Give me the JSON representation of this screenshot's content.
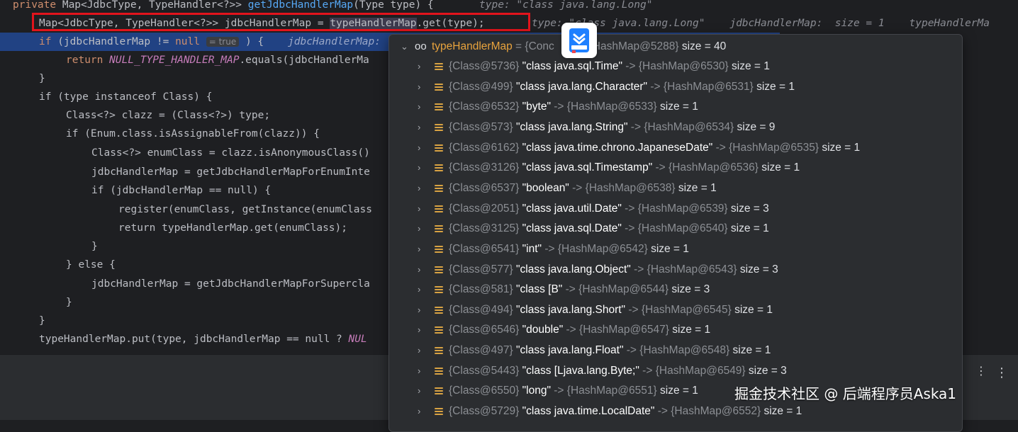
{
  "editor": {
    "line0": {
      "p1": "private ",
      "p2": "Map<JdbcType, TypeHandler<?>> ",
      "fn": "getJdbcHandlerMap",
      "p3": "(Type type) {",
      "hint": "type: \"class java.lang.Long\""
    },
    "line1": {
      "code_a": "Map<JdbcType, TypeHandler<?>> jdbcHandlerMap = ",
      "sel": "typeHandlerMap",
      "code_b": ".get(type);",
      "hint": "type: \"class java.lang.Long\"    jdbcHandlerMap:  size = 1    typeHandlerMa"
    },
    "line2": {
      "kw": "if",
      "code_a": " (jdbcHandlerMap != ",
      "kw2": "null",
      "badge": "= true",
      "code_b": " ) {",
      "hint": "jdbcHandlerMap:"
    },
    "line3": {
      "kw": "return ",
      "const": "NULL_TYPE_HANDLER_MAP",
      "code": ".equals(jdbcHandlerMa"
    },
    "line4": "}",
    "line5": "if (type instanceof Class) {",
    "line6": "Class<?> clazz = (Class<?>) type;",
    "line7": "if (Enum.class.isAssignableFrom(clazz)) {",
    "line8": "Class<?> enumClass = clazz.isAnonymousClass()",
    "line9": "jdbcHandlerMap = getJdbcHandlerMapForEnumInte",
    "line10": "if (jdbcHandlerMap == null) {",
    "line11": "register(enumClass, getInstance(enumClass",
    "line12": "return typeHandlerMap.get(enumClass);",
    "line13": "}",
    "line14": "} else {",
    "line15": "jdbcHandlerMap = getJdbcHandlerMapForSupercla",
    "line16": "}",
    "line17": "}",
    "line18": {
      "code": "typeHandlerMap.put(type, jdbcHandlerMap == null ? ",
      "tail": "NUL"
    }
  },
  "popup": {
    "root": {
      "name": "typeHandlerMap",
      "eq": " = ",
      "ref": "{Conc",
      "ref2": "HashMap@5288}",
      "size": "size = 40"
    },
    "rows": [
      {
        "cls": "{Class@5736}",
        "key": "\"class java.sql.Time\"",
        "map": "{HashMap@6530}",
        "size": "size = 1"
      },
      {
        "cls": "{Class@499}",
        "key": "\"class java.lang.Character\"",
        "map": "{HashMap@6531}",
        "size": "size = 1"
      },
      {
        "cls": "{Class@6532}",
        "key": "\"byte\"",
        "map": "{HashMap@6533}",
        "size": "size = 1"
      },
      {
        "cls": "{Class@573}",
        "key": "\"class java.lang.String\"",
        "map": "{HashMap@6534}",
        "size": "size = 9"
      },
      {
        "cls": "{Class@6162}",
        "key": "\"class java.time.chrono.JapaneseDate\"",
        "map": "{HashMap@6535}",
        "size": "size = 1"
      },
      {
        "cls": "{Class@3126}",
        "key": "\"class java.sql.Timestamp\"",
        "map": "{HashMap@6536}",
        "size": "size = 1"
      },
      {
        "cls": "{Class@6537}",
        "key": "\"boolean\"",
        "map": "{HashMap@6538}",
        "size": "size = 1"
      },
      {
        "cls": "{Class@2051}",
        "key": "\"class java.util.Date\"",
        "map": "{HashMap@6539}",
        "size": "size = 3"
      },
      {
        "cls": "{Class@3125}",
        "key": "\"class java.sql.Date\"",
        "map": "{HashMap@6540}",
        "size": "size = 1"
      },
      {
        "cls": "{Class@6541}",
        "key": "\"int\"",
        "map": "{HashMap@6542}",
        "size": "size = 1"
      },
      {
        "cls": "{Class@577}",
        "key": "\"class java.lang.Object\"",
        "map": "{HashMap@6543}",
        "size": "size = 3"
      },
      {
        "cls": "{Class@581}",
        "key": "\"class [B\"",
        "map": "{HashMap@6544}",
        "size": "size = 3"
      },
      {
        "cls": "{Class@494}",
        "key": "\"class java.lang.Short\"",
        "map": "{HashMap@6545}",
        "size": "size = 1"
      },
      {
        "cls": "{Class@6546}",
        "key": "\"double\"",
        "map": "{HashMap@6547}",
        "size": "size = 1"
      },
      {
        "cls": "{Class@497}",
        "key": "\"class java.lang.Float\"",
        "map": "{HashMap@6548}",
        "size": "size = 1"
      },
      {
        "cls": "{Class@5443}",
        "key": "\"class [Ljava.lang.Byte;\"",
        "map": "{HashMap@6549}",
        "size": "size = 3"
      },
      {
        "cls": "{Class@6550}",
        "key": "\"long\"",
        "map": "{HashMap@6551}",
        "size": "size = 1"
      },
      {
        "cls": "{Class@5729}",
        "key": "\"class java.time.LocalDate\"",
        "map": "{HashMap@6552}",
        "size": "size = 1"
      }
    ],
    "arrow": " -> "
  },
  "toolbar": {
    "more_icon": "⋮",
    "sep_icon": "⋮"
  },
  "watermark": "掘金技术社区 @ 后端程序员Aska1",
  "colors": {
    "accent_red": "#e2141c",
    "field_icon": "#d9a343",
    "selection": "#214283"
  }
}
